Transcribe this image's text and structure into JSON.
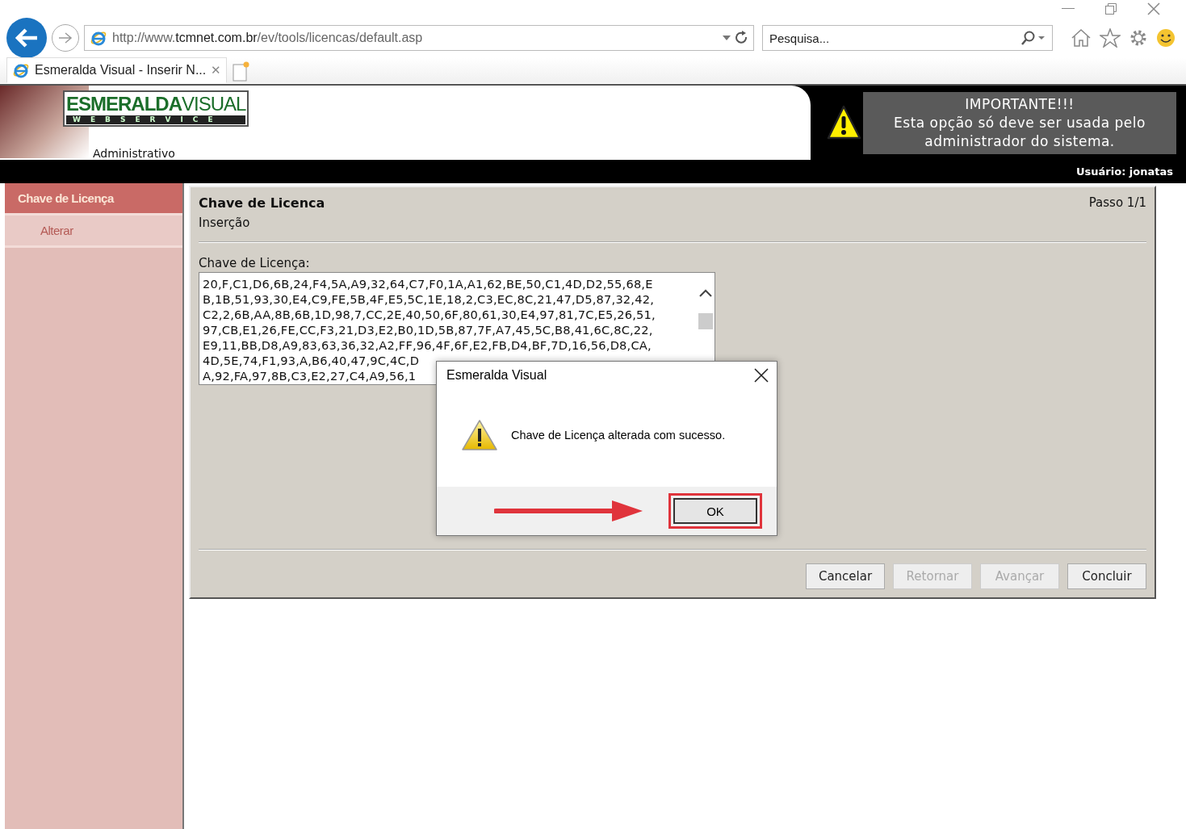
{
  "browser": {
    "url": "http://www.**tcmnet.com.br**/ev/tools/licencas/default.asp",
    "search": {
      "placeholder": "Pesquisa..."
    },
    "tabs": [
      {
        "title": "Esmeralda Visual - Inserir N...",
        "close": "✕",
        "selected": true
      }
    ]
  },
  "header": {
    "logo_primary": "ESMERALDA",
    "logo_secondary": "VISUAL",
    "logo_tagline": "WEBSERVICE",
    "subtitle": "Administrativo",
    "notice_title": "IMPORTANTE!!!",
    "notice_text": "Esta opção só deve ser usada pelo administrador do sistema.",
    "user": "Usuário: jonatas"
  },
  "sidebar": {
    "items": [
      {
        "label": "Chave de Licença",
        "kind": "header"
      },
      {
        "label": "Alterar",
        "kind": "item"
      }
    ]
  },
  "panel": {
    "title": "Chave de Licenca",
    "subtitle": "Inserção",
    "step": "Passo 1/1",
    "field_label": "Chave de Licença:",
    "key_lines": [
      "20,F,C1,D6,6B,24,F4,5A,A9,32,64,C7,F0,1A,A1,62,BE,50,C1,4D,D2,55,68,E",
      "B,1B,51,93,30,E4,C9,FE,5B,4F,E5,5C,1E,18,2,C3,EC,8C,21,47,D5,87,32,42,",
      "C2,2,6B,AA,8B,6B,1D,98,7,CC,2E,40,50,6F,80,61,30,E4,97,81,7C,E5,26,51,",
      "97,CB,E1,26,FE,CC,F3,21,D3,E2,B0,1D,5B,87,7F,A7,45,5C,B8,41,6C,8C,22,",
      "E9,11,BB,D8,A9,83,63,36,32,A2,FF,96,4F,6F,E2,FB,D4,BF,7D,16,56,D8,CA,",
      "4D,5E,74,F1,93,A,B6,40,47,9C,4C,D",
      "A,92,FA,97,8B,C3,E2,27,C4,A9,56,1"
    ],
    "buttons": [
      {
        "label": "Cancelar",
        "disabled": false
      },
      {
        "label": "Retornar",
        "disabled": true
      },
      {
        "label": "Avançar",
        "disabled": true
      },
      {
        "label": "Concluir",
        "disabled": false
      }
    ]
  },
  "dialog": {
    "title": "Esmeralda Visual",
    "message": "Chave de Licença alterada com sucesso.",
    "ok": "OK",
    "ok_highlighted": true
  }
}
